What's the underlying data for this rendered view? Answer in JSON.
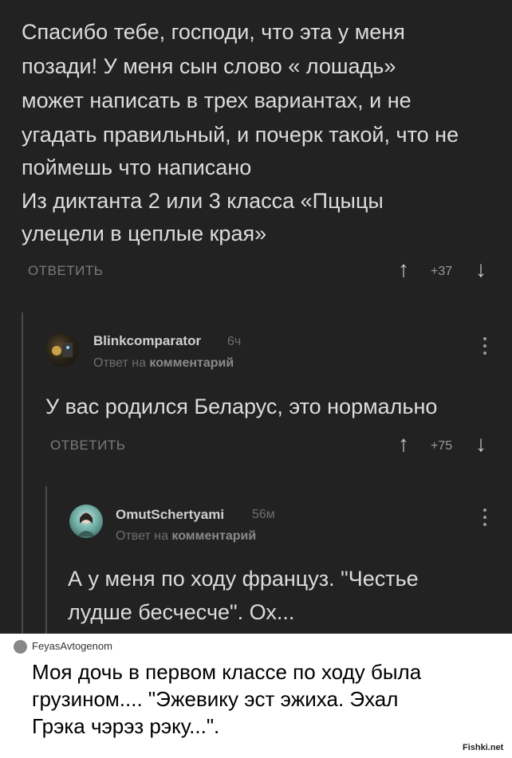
{
  "thread": {
    "first": {
      "lines": [
        "Спасибо тебе, господи, что эта у меня",
        "позади! У меня сын слово « лошадь»",
        "может написать в трех вариантах, и не",
        "угадать правильный, и почерк такой, что не",
        "поймешь что написано",
        "Из диктанта 2 или 3 класса «Пцыцы",
        "улецели в цеплые края»"
      ],
      "reply_label": "ОТВЕТИТЬ",
      "score": "+37"
    },
    "second": {
      "username": "Blinkcomparator",
      "time": "6ч",
      "reply_to_prefix": "Ответ на",
      "reply_to_target": "комментарий",
      "text": "У вас родился Беларус, это нормально",
      "reply_label": "ОТВЕТИТЬ",
      "score": "+75"
    },
    "third": {
      "username": "OmutSchertyami",
      "time": "56м",
      "reply_to_prefix": "Ответ на",
      "reply_to_target": "комментарий",
      "lines": [
        "А у меня по ходу француз. \"Честье",
        "лудше бесчесче\". Ох..."
      ]
    }
  },
  "footer_comment": {
    "username": "FeyasAvtogenom",
    "lines": [
      "Моя дочь в первом классе по ходу была",
      "грузином.... \"Эжевику эст эжиха. Эхал",
      "Грэка чэрэз рэку...\"."
    ]
  },
  "watermark": "Fishki.net",
  "icons": {
    "up": "arrow-up-icon",
    "down": "arrow-down-icon",
    "menu": "kebab-menu-icon"
  },
  "colors": {
    "background": "#222222",
    "text": "#dcdcdc",
    "muted": "#6f6f6f"
  }
}
